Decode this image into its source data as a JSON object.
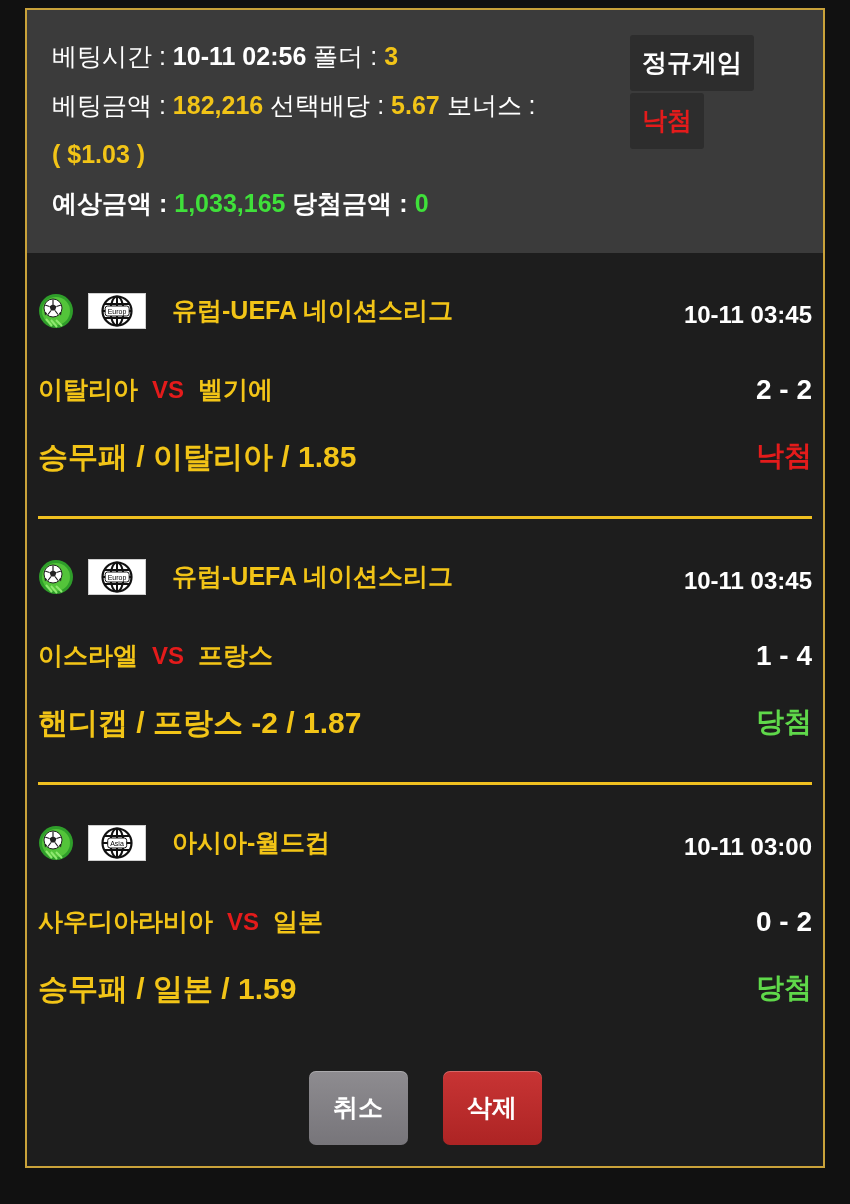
{
  "summary": {
    "lines": [
      {
        "segments": [
          {
            "text": "베팅시간 :",
            "bold": false,
            "color": "#ffffff"
          },
          {
            "text": "10-11 02:56",
            "bold": true,
            "color": "#ffffff"
          },
          {
            "text": "폴더 :",
            "bold": false,
            "color": "#ffffff"
          },
          {
            "text": "3",
            "bold": true,
            "color": "#f2c417"
          }
        ]
      },
      {
        "segments": [
          {
            "text": "베팅금액 :",
            "bold": false,
            "color": "#ffffff"
          },
          {
            "text": "182,216",
            "bold": true,
            "color": "#f2c417"
          },
          {
            "text": "선택배당 :",
            "bold": false,
            "color": "#ffffff"
          },
          {
            "text": "5.67",
            "bold": true,
            "color": "#f2c417"
          },
          {
            "text": "보너스 :",
            "bold": false,
            "color": "#ffffff"
          },
          {
            "text": "( $1.03 )",
            "bold": true,
            "color": "#f2c417"
          }
        ]
      },
      {
        "segments": [
          {
            "text": "예상금액 :",
            "bold": true,
            "color": "#ffffff"
          },
          {
            "text": "1,033,165",
            "bold": true,
            "color": "#3fe03a"
          },
          {
            "text": "당첨금액 :",
            "bold": true,
            "color": "#ffffff"
          },
          {
            "text": "0",
            "bold": true,
            "color": "#3fe03a"
          }
        ]
      }
    ],
    "badges": [
      {
        "text": "정규게임",
        "color": "#ffffff"
      },
      {
        "text": "낙첨",
        "color": "#e41b1b"
      }
    ]
  },
  "bets": [
    {
      "region": "Europ",
      "league": "유럽-UEFA 네이션스리그",
      "time": "10-11 03:45",
      "home": "이탈리아",
      "vs": "VS",
      "away": "벨기에",
      "score": "2 - 2",
      "pick": "승무패 / 이탈리아 / 1.85",
      "result": {
        "text": "낙첨",
        "won": false
      }
    },
    {
      "region": "Europ",
      "league": "유럽-UEFA 네이션스리그",
      "time": "10-11 03:45",
      "home": "이스라엘",
      "vs": "VS",
      "away": "프랑스",
      "score": "1 - 4",
      "pick": "핸디캡 / 프랑스 -2 / 1.87",
      "result": {
        "text": "당첨",
        "won": true
      }
    },
    {
      "region": "Asia",
      "league": "아시아-월드컵",
      "time": "10-11 03:00",
      "home": "사우디아라비아",
      "vs": "VS",
      "away": "일본",
      "score": "0 - 2",
      "pick": "승무패 / 일본 / 1.59",
      "result": {
        "text": "당첨",
        "won": true
      }
    }
  ],
  "buttons": [
    {
      "label": "취소",
      "kind": "cancel"
    },
    {
      "label": "삭제",
      "kind": "delete"
    }
  ]
}
